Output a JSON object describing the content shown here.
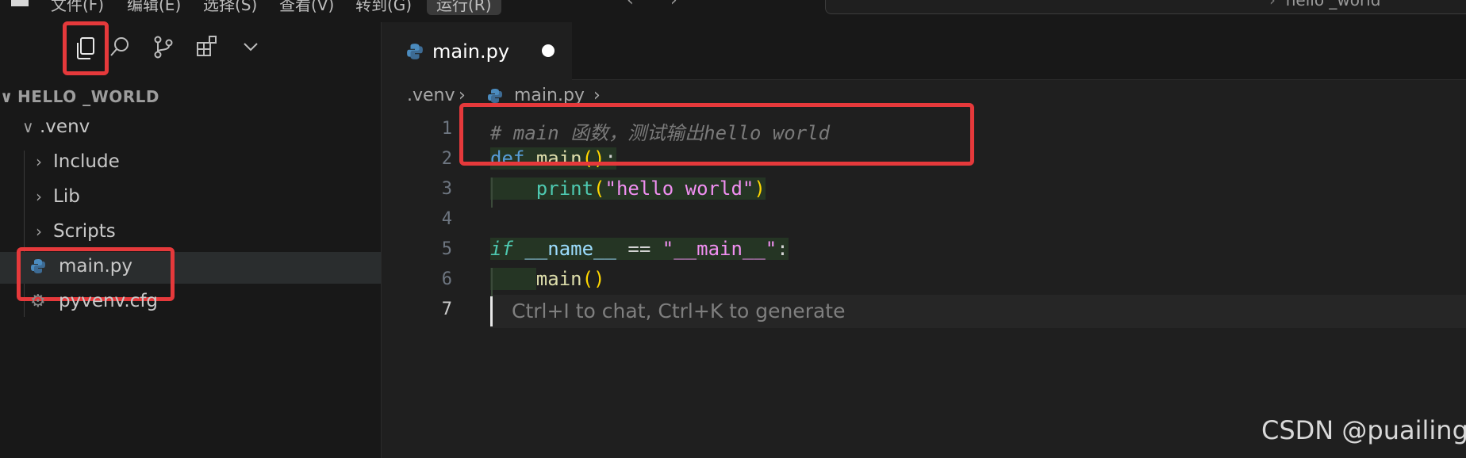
{
  "menubar": {
    "items": [
      "文件(F)",
      "编辑(E)",
      "选择(S)",
      "查看(V)",
      "转到(G)",
      "运行(R)"
    ],
    "search_text": "hello _world"
  },
  "sidebar": {
    "root": "HELLO _WORLD",
    "items": [
      {
        "label": ".venv",
        "type": "folder-open"
      },
      {
        "label": "Include",
        "type": "folder"
      },
      {
        "label": "Lib",
        "type": "folder"
      },
      {
        "label": "Scripts",
        "type": "folder"
      },
      {
        "label": "main.py",
        "type": "python-file",
        "selected": true
      },
      {
        "label": "pyvenv.cfg",
        "type": "config-file"
      }
    ]
  },
  "editor": {
    "tab": {
      "label": "main.py",
      "dirty": true
    },
    "breadcrumb": [
      ".venv",
      "main.py"
    ],
    "line_numbers": [
      "1",
      "2",
      "3",
      "4",
      "5",
      "6",
      "7"
    ],
    "code": {
      "comment": "# main 函数，测试输出hello world",
      "def_kw": "def",
      "fn_name": "main",
      "print": "print",
      "hello_str": "\"hello world\"",
      "if_kw": "if",
      "dunder_name": "__name__",
      "eq": "==",
      "main_str": "\"__main__\"",
      "colon": ":",
      "call_main": "main"
    },
    "hint": "Ctrl+I to chat, Ctrl+K to generate"
  },
  "watermark": "CSDN @puailing",
  "colors": {
    "highlight": "#e5393b",
    "accent": "#569cd6"
  }
}
